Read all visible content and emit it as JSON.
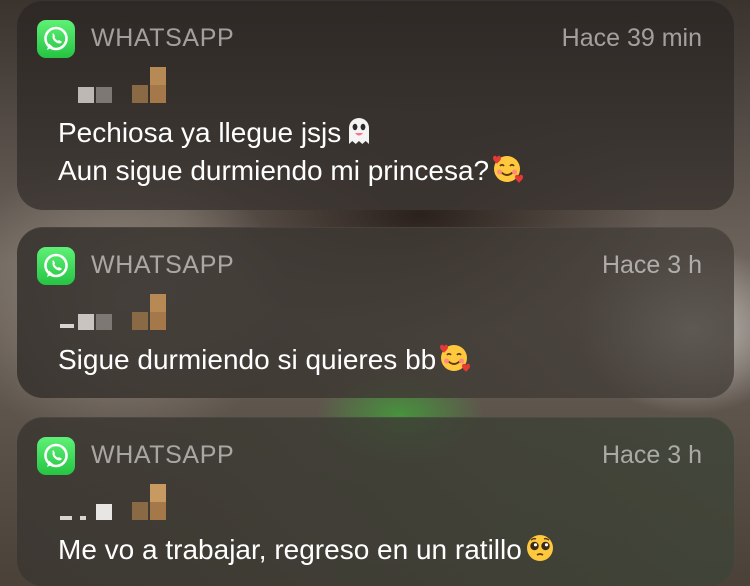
{
  "notifications": [
    {
      "app_name": "WHATSAPP",
      "time": "Hace 39 min",
      "app_icon": "whatsapp-icon",
      "sender": "redacted",
      "lines": [
        {
          "text": "Pechiosa ya llegue jsjs",
          "emoji": "ghost-emoji"
        },
        {
          "text": "Aun sigue durmiendo mi princesa?",
          "emoji": "smiling-face-with-hearts-emoji"
        }
      ]
    },
    {
      "app_name": "WHATSAPP",
      "time": "Hace 3 h",
      "app_icon": "whatsapp-icon",
      "sender": "redacted",
      "lines": [
        {
          "text": "Sigue durmiendo si quieres bb",
          "emoji": "smiling-face-with-hearts-emoji"
        }
      ]
    },
    {
      "app_name": "WHATSAPP",
      "time": "Hace 3 h",
      "app_icon": "whatsapp-icon",
      "sender": "redacted",
      "lines": [
        {
          "text": "Me vo a trabajar, regreso en un ratillo",
          "emoji": "pleading-face-emoji"
        }
      ]
    }
  ],
  "colors": {
    "whatsapp_green": "#25d366",
    "card_bg": "#3a3430",
    "secondary_text": "#9a9490"
  }
}
